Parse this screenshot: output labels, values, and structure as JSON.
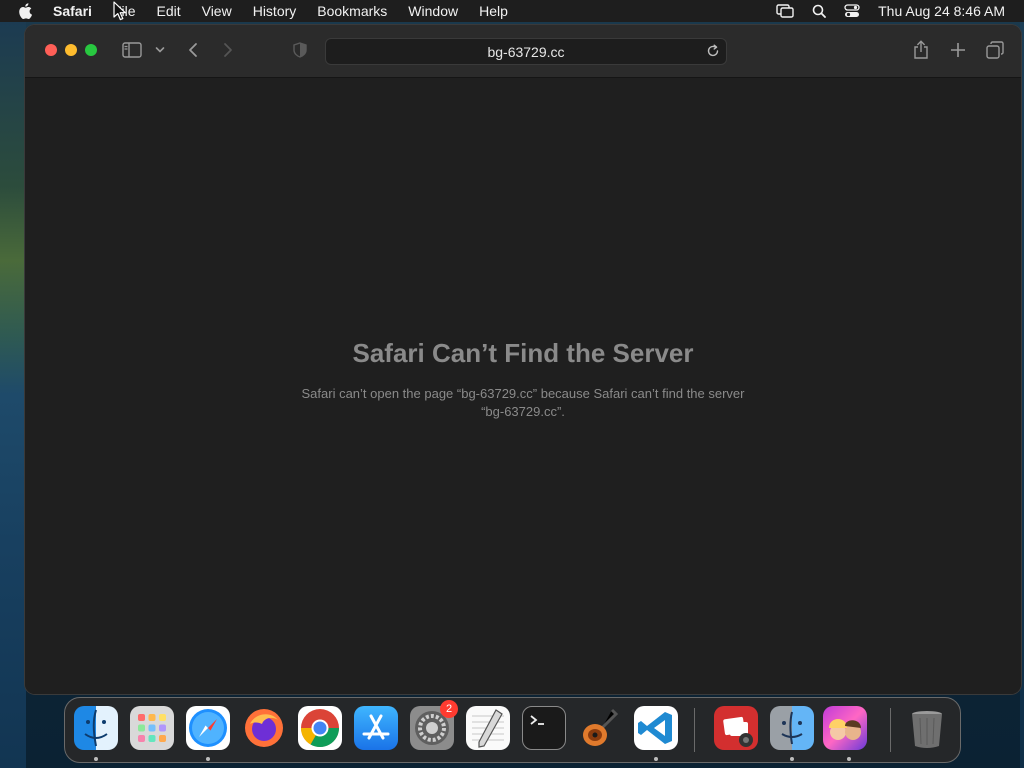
{
  "menubar": {
    "app": "Safari",
    "items": [
      "File",
      "Edit",
      "View",
      "History",
      "Bookmarks",
      "Window",
      "Help"
    ],
    "clock": "Thu Aug 24  8:46 AM",
    "status_icons": [
      "screen-mirroring-icon",
      "spotlight-search-icon",
      "control-center-icon"
    ]
  },
  "browser": {
    "url": "bg-63729.cc",
    "toolbar_icons": [
      "sidebar-icon",
      "chevron-down-icon",
      "back-icon",
      "forward-icon",
      "privacy-shield-icon",
      "reload-icon",
      "share-icon",
      "new-tab-icon",
      "tab-overview-icon"
    ]
  },
  "error": {
    "title": "Safari Can’t Find the Server",
    "message": "Safari can’t open the page “bg-63729.cc” because Safari can’t find the server “bg-63729.cc”."
  },
  "dock": {
    "apps": [
      "Finder",
      "Launchpad",
      "Safari",
      "Firefox",
      "Google Chrome",
      "App Store",
      "System Settings",
      "TextEdit",
      "Terminal",
      "GarageBand",
      "Visual Studio Code",
      "Photo Booth",
      "Migration Assistant",
      "Game",
      "Trash"
    ],
    "settings_badge": "2"
  },
  "colors": {
    "menubar_bg": "#1e1e1e",
    "window_bg": "#1f1f1f",
    "toolbar_bg": "#2b2b2b",
    "error_text": "#8a8a8a"
  }
}
